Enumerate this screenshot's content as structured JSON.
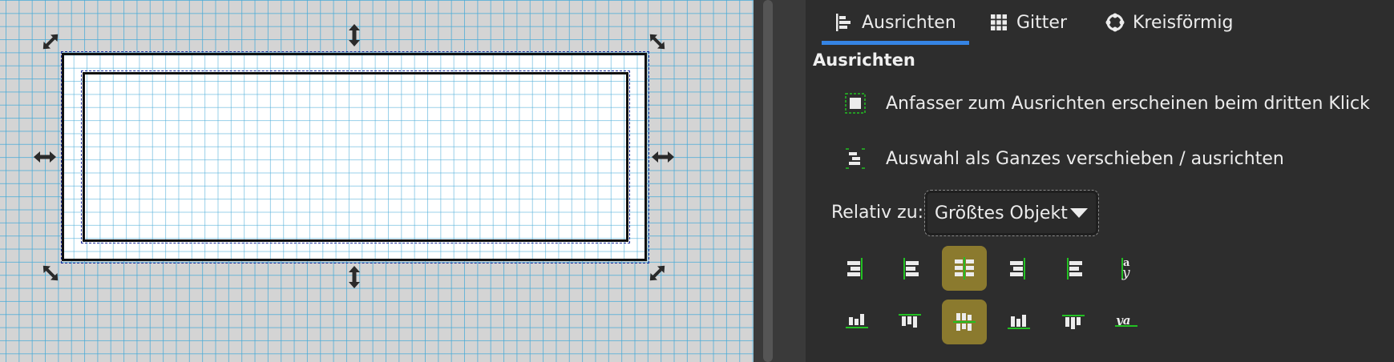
{
  "tabs": [
    {
      "label": "Ausrichten",
      "icon": "align-left-icon",
      "active": true
    },
    {
      "label": "Gitter",
      "icon": "grid-icon",
      "active": false
    },
    {
      "label": "Kreisförmig",
      "icon": "circular-icon",
      "active": false
    }
  ],
  "section": {
    "title": "Ausrichten"
  },
  "options": {
    "handles_third_click": {
      "label": "Anfasser zum Ausrichten erscheinen beim dritten Klick",
      "icon": "align-handles-icon"
    },
    "move_as_group": {
      "label": "Auswahl als Ganzes verschieben / ausrichten",
      "icon": "group-align-icon"
    }
  },
  "relative_to": {
    "label": "Relativ zu:",
    "value": "Größtes Objekt"
  },
  "colors": {
    "accent": "#3584e4",
    "active_button": "#8b7a2e",
    "panel_bg": "#2d2d2d",
    "guide": "#22c022"
  },
  "align_buttons_row1": [
    {
      "name": "align-right-edges-to-left-anchor",
      "active": false
    },
    {
      "name": "align-left-edges",
      "active": false
    },
    {
      "name": "center-on-vertical-axis",
      "active": true
    },
    {
      "name": "align-right-edges",
      "active": false
    },
    {
      "name": "align-left-edges-to-right-anchor",
      "active": false
    },
    {
      "name": "align-text-baselines-vertical",
      "active": false
    }
  ],
  "align_buttons_row2": [
    {
      "name": "align-bottom-edges-to-top-anchor",
      "active": false
    },
    {
      "name": "align-top-edges",
      "active": false
    },
    {
      "name": "center-on-horizontal-axis",
      "active": true
    },
    {
      "name": "align-bottom-edges",
      "active": false
    },
    {
      "name": "align-top-edges-to-bottom-anchor",
      "active": false
    },
    {
      "name": "align-text-baselines-horizontal",
      "active": false
    }
  ],
  "baseline_glyphs": {
    "vertical": "a",
    "vertical2": "y",
    "horizontal": "ya"
  }
}
